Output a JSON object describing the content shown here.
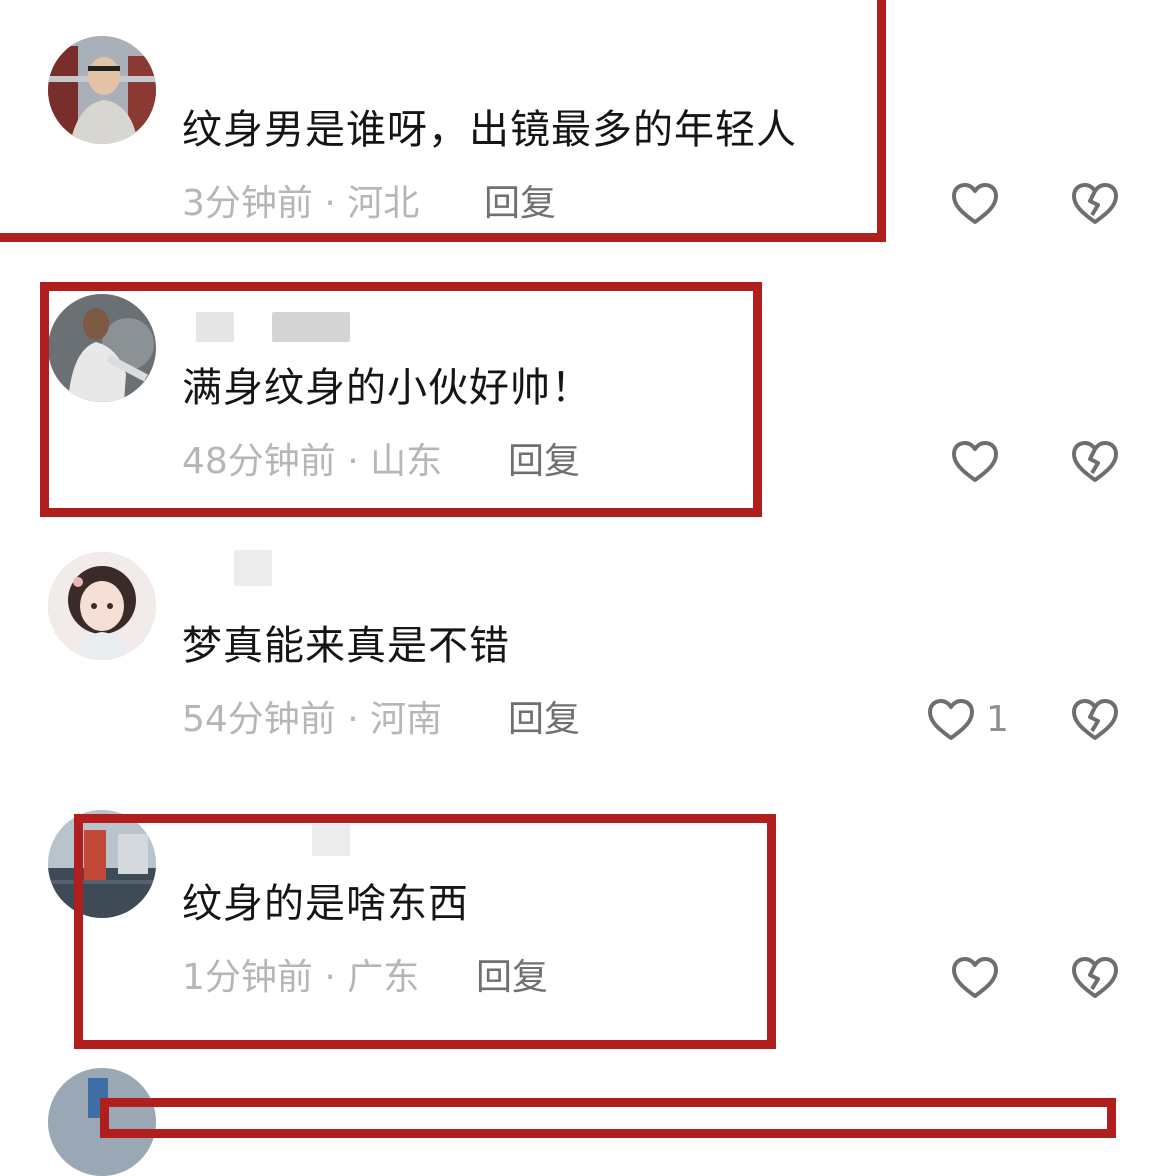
{
  "colors": {
    "frame": "#b01e1e",
    "text": "#151515",
    "meta": "#b6b6b6",
    "reply": "#707070",
    "icon": "#6e6e6e"
  },
  "comments": [
    {
      "text": "纹身男是谁呀，出镜最多的年轻人",
      "time": "3分钟前",
      "location": "河北",
      "meta": "3分钟前 · 河北",
      "reply_label": "回复",
      "like_count": "",
      "icons": [
        "like-heart-icon",
        "dislike-broken-heart-icon"
      ]
    },
    {
      "text": "满身纹身的小伙好帅！",
      "time": "48分钟前",
      "location": "山东",
      "meta": "48分钟前 · 山东",
      "reply_label": "回复",
      "like_count": "",
      "icons": [
        "like-heart-icon",
        "dislike-broken-heart-icon"
      ]
    },
    {
      "text": "梦真能来真是不错",
      "time": "54分钟前",
      "location": "河南",
      "meta": "54分钟前 · 河南",
      "reply_label": "回复",
      "like_count": "1",
      "icons": [
        "like-heart-icon",
        "dislike-broken-heart-icon"
      ]
    },
    {
      "text": "纹身的是啥东西",
      "time": "1分钟前",
      "location": "广东",
      "meta": "1分钟前 · 广东",
      "reply_label": "回复",
      "like_count": "",
      "icons": [
        "like-heart-icon",
        "dislike-broken-heart-icon"
      ]
    }
  ]
}
